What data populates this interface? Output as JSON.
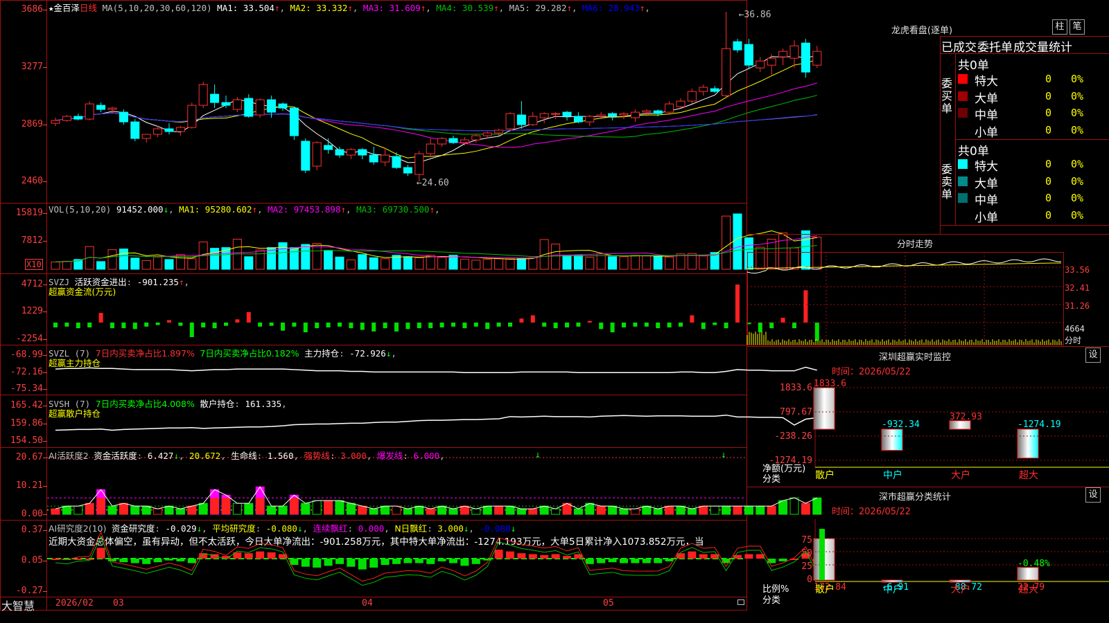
{
  "app": {
    "brand": "大智慧",
    "stock_name": "金百泽",
    "period": "日线",
    "star": "★"
  },
  "main_chart": {
    "ma_label": "MA(5,10,20,30,60,120)",
    "ma_values": [
      {
        "name": "MA1",
        "value": "33.504",
        "arrow": "↑",
        "color": "#ffffff"
      },
      {
        "name": "MA2",
        "value": "33.332",
        "arrow": "↑",
        "color": "#ffff00"
      },
      {
        "name": "MA3",
        "value": "31.609",
        "arrow": "↑",
        "color": "#ff00ff"
      },
      {
        "name": "MA4",
        "value": "30.539",
        "arrow": "↑",
        "color": "#00c000"
      },
      {
        "name": "MA5",
        "value": "29.282",
        "arrow": "↑",
        "color": "#c0c0c0"
      },
      {
        "name": "MA6",
        "value": "28.943",
        "arrow": "↑",
        "color": "#0000ff"
      }
    ],
    "y_ticks": [
      "3686",
      "3277",
      "2869",
      "2460"
    ],
    "high_marker": "36.86",
    "low_marker": "24.60"
  },
  "chart_data": [
    {
      "type": "candlestick",
      "title": "金百泽 日线",
      "ylim": [
        24.6,
        36.86
      ],
      "dates": [
        "2026/02",
        "03",
        "04",
        "05"
      ],
      "ohlc": [
        [
          28.8,
          29.2,
          28.6,
          29.0
        ],
        [
          29.0,
          29.4,
          28.9,
          29.3
        ],
        [
          29.3,
          29.5,
          29.0,
          29.1
        ],
        [
          29.1,
          30.4,
          29.0,
          30.2
        ],
        [
          30.1,
          30.3,
          29.6,
          29.8
        ],
        [
          29.8,
          30.0,
          29.5,
          29.9
        ],
        [
          29.6,
          29.8,
          28.7,
          28.9
        ],
        [
          28.9,
          29.1,
          27.5,
          27.7
        ],
        [
          27.7,
          28.0,
          27.4,
          28.0
        ],
        [
          28.0,
          28.6,
          27.8,
          28.4
        ],
        [
          28.4,
          28.8,
          28.0,
          28.2
        ],
        [
          28.2,
          28.6,
          27.9,
          28.5
        ],
        [
          28.5,
          30.3,
          28.4,
          30.1
        ],
        [
          30.1,
          31.8,
          29.9,
          31.6
        ],
        [
          30.9,
          31.6,
          29.9,
          30.3
        ],
        [
          30.3,
          30.8,
          29.9,
          30.1
        ],
        [
          29.8,
          30.7,
          29.6,
          30.5
        ],
        [
          30.6,
          30.9,
          29.2,
          29.3
        ],
        [
          29.4,
          30.6,
          29.2,
          30.5
        ],
        [
          30.5,
          30.8,
          29.2,
          29.6
        ],
        [
          30.2,
          30.3,
          29.7,
          29.9
        ],
        [
          29.9,
          30.0,
          27.6,
          27.9
        ],
        [
          27.5,
          27.7,
          25.2,
          25.4
        ],
        [
          25.7,
          27.5,
          25.4,
          27.4
        ],
        [
          27.2,
          27.7,
          26.6,
          26.9
        ],
        [
          26.9,
          27.1,
          26.3,
          26.5
        ],
        [
          26.5,
          27.0,
          26.2,
          26.9
        ],
        [
          26.9,
          27.0,
          26.2,
          26.5
        ],
        [
          26.5,
          27.1,
          25.8,
          26.0
        ],
        [
          26.0,
          27.0,
          25.7,
          26.5
        ],
        [
          26.4,
          26.7,
          25.5,
          25.6
        ],
        [
          25.6,
          25.8,
          25.0,
          25.2
        ],
        [
          25.1,
          26.8,
          24.6,
          26.6
        ],
        [
          26.6,
          27.7,
          26.4,
          27.3
        ],
        [
          27.3,
          27.8,
          27.1,
          27.7
        ],
        [
          27.7,
          27.9,
          27.3,
          27.4
        ],
        [
          27.4,
          27.8,
          27.2,
          27.6
        ],
        [
          27.6,
          28.0,
          27.4,
          27.9
        ],
        [
          27.9,
          28.2,
          27.7,
          28.1
        ],
        [
          28.1,
          28.4,
          27.9,
          28.3
        ],
        [
          28.4,
          29.6,
          28.2,
          29.5
        ],
        [
          29.4,
          30.4,
          28.4,
          28.7
        ],
        [
          28.7,
          29.6,
          28.6,
          29.3
        ],
        [
          29.2,
          29.6,
          28.8,
          29.5
        ],
        [
          29.5,
          29.6,
          29.1,
          29.5
        ],
        [
          29.6,
          29.7,
          29.0,
          29.3
        ],
        [
          29.3,
          29.6,
          28.8,
          28.9
        ],
        [
          28.9,
          29.4,
          28.6,
          29.3
        ],
        [
          29.3,
          29.6,
          29.1,
          29.4
        ],
        [
          29.5,
          29.6,
          29.0,
          29.3
        ],
        [
          29.4,
          29.6,
          29.1,
          29.5
        ],
        [
          29.2,
          29.8,
          28.9,
          29.6
        ],
        [
          29.6,
          29.8,
          29.3,
          29.7
        ],
        [
          29.7,
          29.8,
          29.3,
          29.5
        ],
        [
          29.6,
          30.4,
          29.4,
          30.2
        ],
        [
          30.0,
          30.6,
          29.9,
          30.4
        ],
        [
          30.4,
          31.3,
          30.2,
          31.1
        ],
        [
          31.1,
          31.6,
          30.8,
          31.4
        ],
        [
          31.3,
          31.5,
          31.0,
          31.1
        ],
        [
          30.8,
          36.86,
          30.6,
          34.2
        ],
        [
          34.7,
          34.9,
          33.9,
          34.1
        ],
        [
          34.5,
          34.9,
          32.7,
          33.0
        ],
        [
          32.8,
          33.6,
          32.5,
          33.3
        ],
        [
          33.0,
          33.8,
          32.3,
          33.5
        ],
        [
          33.6,
          34.2,
          33.0,
          34.0
        ],
        [
          33.5,
          34.8,
          32.8,
          34.4
        ],
        [
          34.6,
          34.9,
          32.1,
          32.5
        ],
        [
          33.0,
          34.4,
          32.8,
          34.0
        ]
      ]
    },
    {
      "type": "bar",
      "title": "VOL(5,10,20)",
      "ylim": [
        0,
        15819
      ],
      "values": [
        2100,
        2300,
        2800,
        6500,
        2200,
        5600,
        5800,
        3200,
        2500,
        3500,
        2800,
        4200,
        3000,
        7800,
        6000,
        6200,
        8600,
        3600,
        5500,
        6200,
        7600,
        6200,
        7100,
        7400,
        5400,
        3500,
        2700,
        4200,
        3300,
        3000,
        4000,
        3600,
        3300,
        4000,
        3400,
        4000,
        2900,
        2600,
        2800,
        3000,
        3000,
        3200,
        3300,
        8500,
        7200,
        4000,
        4000,
        3400,
        4400,
        3600,
        3600,
        4000,
        3800,
        3800,
        3500,
        4400,
        4500,
        3800,
        4800,
        15200,
        15819,
        9000,
        6300,
        8600,
        10400,
        6100,
        11000,
        9200
      ]
    }
  ],
  "vol_panel": {
    "label": "VOL(5,10,20)",
    "value": "91452.000",
    "value_arrow": "↓",
    "mas": [
      {
        "name": "MA1",
        "value": "95280.602",
        "arrow": "↑",
        "color": "#ffff00"
      },
      {
        "name": "MA2",
        "value": "97453.898",
        "arrow": "↑",
        "color": "#ff00ff"
      },
      {
        "name": "MA3",
        "value": "69730.500",
        "arrow": "↑",
        "color": "#00c000"
      }
    ],
    "y_ticks": [
      "15819",
      "7812"
    ],
    "unit": "X10"
  },
  "svzj_panel": {
    "label": "SVZJ",
    "metric": "活跃资金进出",
    "value": "-901.235",
    "arrow": "↑",
    "subtitle": "超赢资金流(万元)",
    "y_ticks": [
      "4712",
      "1229",
      "-2254"
    ]
  },
  "svzl_panel": {
    "label": "SVZL (7)",
    "item1": "7日内买卖净占比1.897%",
    "item2": "7日内买卖净占比0.182%",
    "item3_label": "主力持仓",
    "item3_value": "-72.926",
    "item3_arrow": "↓",
    "subtitle": "超赢主力持仓",
    "y_ticks": [
      "-68.99",
      "-72.16",
      "-75.34"
    ]
  },
  "svsh_panel": {
    "label": "SVSH (7)",
    "item1": "7日内买卖净占比4.008%",
    "item2_label": "散户持仓",
    "item2_value": "161.335",
    "subtitle": "超赢散户持仓",
    "y_ticks": [
      "165.42",
      "159.86",
      "154.50"
    ]
  },
  "ai_active_panel": {
    "label": "AI活跃度2",
    "metric": "资金活跃度",
    "value": "6.427",
    "arrow": "↓",
    "value2": "20.672",
    "life_line_label": "生命线",
    "life_line_value": "1.560",
    "strong_label": "强势线",
    "strong_value": "3.000",
    "burst_label": "爆发线",
    "burst_value": "6.000",
    "y_ticks": [
      "20.67",
      "10.21",
      "0.00"
    ]
  },
  "ai_research_panel": {
    "label": "AI研究度2(10)",
    "metric": "资金研究度",
    "value": "-0.029",
    "avg_label": "平均研究度",
    "avg_value": "-0.080",
    "red_label": "连续飘红",
    "red_value": "0.000",
    "nred_label": "N日飘红",
    "nred_value": "3.000",
    "last_value": "-0.080",
    "commentary": "近期大资金总体偏空，虽有异动，但不太活跃，今日大单净流出：-901.258万元，其中特大单净流出：-1274.193万元，大单5日累计净入1073.852万元，当",
    "y_ticks": [
      "0.37",
      "0.05",
      "-0.27"
    ]
  },
  "time_axis": {
    "labels": [
      "2026/02",
      "03",
      "04",
      "05"
    ]
  },
  "dragon_tiger": {
    "title": "龙虎看盘(逐单)",
    "btn_column": "柱",
    "btn_stroke": "笔",
    "tabs": [
      "已成交",
      "委托单",
      "成交量统计"
    ],
    "buy": {
      "side_label": "委买单",
      "total": "共0单",
      "rows": [
        {
          "label": "特大",
          "count": "0",
          "pct": "0%",
          "color": "#ff0000"
        },
        {
          "label": "大单",
          "count": "0",
          "pct": "0%",
          "color": "#a00000"
        },
        {
          "label": "中单",
          "count": "0",
          "pct": "0%",
          "color": "#700000"
        },
        {
          "label": "小单",
          "count": "0",
          "pct": "0%",
          "color": ""
        }
      ]
    },
    "sell": {
      "side_label": "委卖单",
      "total": "共0单",
      "rows": [
        {
          "label": "特大",
          "count": "0",
          "pct": "0%",
          "color": "#00ffff"
        },
        {
          "label": "大单",
          "count": "0",
          "pct": "0%",
          "color": "#008c8c"
        },
        {
          "label": "中单",
          "count": "0",
          "pct": "0%",
          "color": "#007070"
        },
        {
          "label": "小单",
          "count": "0",
          "pct": "0%",
          "color": ""
        }
      ]
    }
  },
  "intraday": {
    "title": "分时走势",
    "y_ticks": [
      "33.56",
      "32.41",
      "31.26"
    ],
    "vol_tick": "4664",
    "vol_unit": "分时"
  },
  "sz_monitor": {
    "title": "深圳超赢实时监控",
    "btn": "设",
    "time": "时间：2026/05/22",
    "y_ticks": [
      "1833.6",
      "797.67",
      "-238.26",
      "-1274.19"
    ],
    "axis_label1": "净额(万元)",
    "axis_label2": "分类",
    "bars": [
      {
        "cat": "散户",
        "value": 1833.6,
        "label": "1833.6"
      },
      {
        "cat": "中户",
        "value": -932.34,
        "label": "-932.34"
      },
      {
        "cat": "大户",
        "value": 372.93,
        "label": "372.93"
      },
      {
        "cat": "超大",
        "value": -1274.19,
        "label": "-1274.19"
      }
    ]
  },
  "sz_category": {
    "title": "深市超赢分类统计",
    "btn": "设",
    "time": "时间：2026/05/22",
    "y_ticks": [
      "75",
      "50",
      "25",
      "0"
    ],
    "axis_label1": "比例%",
    "axis_label2": "分类",
    "bars": [
      {
        "cat": "散户",
        "value": 172.84,
        "label": "172.84"
      },
      {
        "cat": "中户",
        "value": -6.91,
        "label": "-6.91"
      },
      {
        "cat": "大户",
        "value": -88.72,
        "label": "-88.72"
      },
      {
        "cat": "超大",
        "value": 22.79,
        "label": "22.79",
        "pct_label": "-0.48%"
      }
    ]
  }
}
